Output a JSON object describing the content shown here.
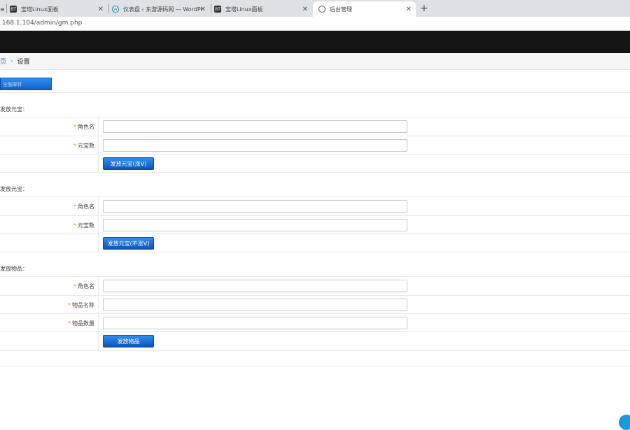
{
  "browser": {
    "tabs": [
      {
        "label": "宝塔Linux面板",
        "icon": "bt-panel-icon"
      },
      {
        "label": "仪表盘 ‹ 东游源码网 — WordPr",
        "icon": "wordpress-icon"
      },
      {
        "label": "宝塔Linux面板",
        "icon": "bt-panel-icon"
      },
      {
        "label": "后台管理",
        "icon": "globe-icon"
      }
    ],
    "close_glyph": "✕",
    "new_tab_glyph": "+",
    "url": ".168.1.104/admin/gm.php"
  },
  "breadcrumb": {
    "home": "页",
    "separator": "›",
    "current": "设置"
  },
  "tab_button": {
    "label": "全服邮件"
  },
  "sections": [
    {
      "title": "发放元宝：",
      "fields": [
        {
          "label": "角色名",
          "required": true,
          "value": ""
        },
        {
          "label": "元宝数",
          "required": true,
          "value": ""
        }
      ],
      "submit": "发放元宝(涨V)"
    },
    {
      "title": "发放元宝：",
      "fields": [
        {
          "label": "角色名",
          "required": true,
          "value": ""
        },
        {
          "label": "元宝数",
          "required": true,
          "value": ""
        }
      ],
      "submit": "发放元宝(不涨V)"
    },
    {
      "title": "发放物品：",
      "fields": [
        {
          "label": "角色名",
          "required": true,
          "value": ""
        },
        {
          "label": "物品名称",
          "required": true,
          "value": ""
        },
        {
          "label": "物品数量",
          "required": true,
          "value": ""
        }
      ],
      "submit": "发放物品"
    }
  ],
  "required_mark": "*",
  "colors": {
    "accent": "#1e7fd6",
    "button": "#1262c8",
    "required": "#e08a00",
    "topbar": "#141414"
  }
}
